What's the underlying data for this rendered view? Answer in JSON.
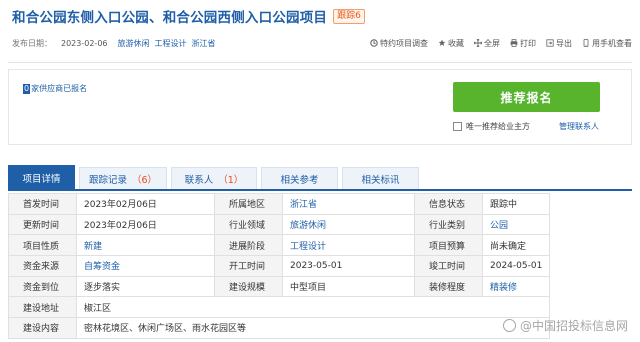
{
  "header": {
    "title": "和合公园东侧入口公园、和合公园西侧入口公园项目",
    "badge": "跟踪6"
  },
  "meta": {
    "publish_label": "发布日期：",
    "publish_date": "2023-02-06",
    "tags": [
      "旅游休闲",
      "工程设计",
      "浙江省"
    ],
    "actions": [
      {
        "icon": "survey-icon",
        "label": "特约项目调查"
      },
      {
        "icon": "star-icon",
        "label": "收藏"
      },
      {
        "icon": "fullscreen-icon",
        "label": "全屏"
      },
      {
        "icon": "print-icon",
        "label": "打印"
      },
      {
        "icon": "export-icon",
        "label": "导出"
      },
      {
        "icon": "phone-icon",
        "label": "用手机查看"
      }
    ]
  },
  "signup": {
    "count": "0",
    "count_text": "家供应商已报名",
    "button": "推荐报名",
    "only_one": "唯一推荐给业主方",
    "manage": "管理联系人"
  },
  "tabs": [
    {
      "label": "项目详情",
      "count": ""
    },
    {
      "label": "跟踪记录",
      "count": "（6）"
    },
    {
      "label": "联系人",
      "count": "（1）"
    },
    {
      "label": "相关参考",
      "count": ""
    },
    {
      "label": "相关标讯",
      "count": ""
    }
  ],
  "details": {
    "rows": [
      [
        [
          "首发时间",
          "2023年02月06日",
          false
        ],
        [
          "所属地区",
          "浙江省",
          true
        ],
        [
          "信息状态",
          "跟踪中",
          false
        ]
      ],
      [
        [
          "更新时间",
          "2023年02月06日",
          false
        ],
        [
          "行业领域",
          "旅游休闲",
          true
        ],
        [
          "行业类别",
          "公园",
          true
        ]
      ],
      [
        [
          "项目性质",
          "新建",
          true
        ],
        [
          "进展阶段",
          "工程设计",
          true
        ],
        [
          "项目预算",
          "尚未确定",
          false
        ]
      ],
      [
        [
          "资金来源",
          "自筹资金",
          true
        ],
        [
          "开工时间",
          "2023-05-01",
          false
        ],
        [
          "竣工时间",
          "2024-05-01",
          false
        ]
      ],
      [
        [
          "资金到位",
          "逐步落实",
          false
        ],
        [
          "建设规模",
          "中型项目",
          false
        ],
        [
          "装修程度",
          "精装修",
          true
        ]
      ]
    ],
    "address_label": "建设地址",
    "address": "椒江区",
    "content_label": "建设内容",
    "content": "密林花境区、休闲广场区、雨水花园区等"
  },
  "watermark": "@中国招投标信息网"
}
